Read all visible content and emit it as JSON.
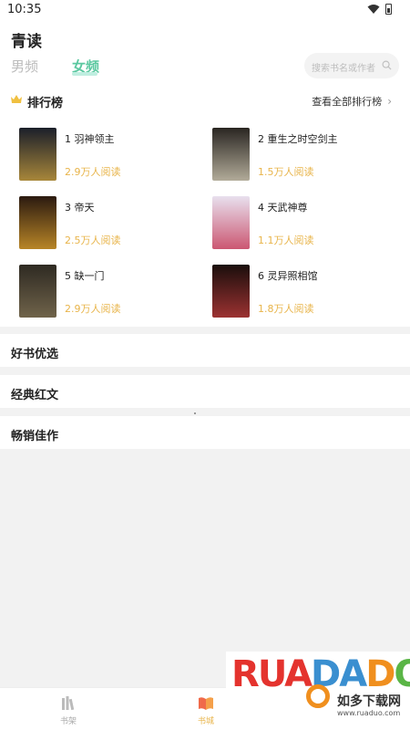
{
  "status": {
    "time": "10:35"
  },
  "header": {
    "title": "青读",
    "tabs": [
      {
        "label": "男频",
        "active": false
      },
      {
        "label": "女频",
        "active": true
      }
    ],
    "search_placeholder": "搜索书名或作者"
  },
  "ranking": {
    "title": "排行榜",
    "view_all": "查看全部排行榜",
    "books": [
      {
        "name": "1 羽神领主",
        "reads": "2.9万人阅读",
        "cover_color": "#1b1f2a",
        "cover_accent": "#e0b040"
      },
      {
        "name": "2 重生之时空剑主",
        "reads": "1.5万人阅读",
        "cover_color": "#2a2622",
        "cover_accent": "#e8e0c8"
      },
      {
        "name": "3 帝天",
        "reads": "2.5万人阅读",
        "cover_color": "#2b1a10",
        "cover_accent": "#f0b030"
      },
      {
        "name": "4 天武神尊",
        "reads": "1.1万人阅读",
        "cover_color": "#e8e0ee",
        "cover_accent": "#c02040"
      },
      {
        "name": "5 缺一门",
        "reads": "2.9万人阅读",
        "cover_color": "#2e2a22",
        "cover_accent": "#8a7a5a"
      },
      {
        "name": "6 灵异照相馆",
        "reads": "1.8万人阅读",
        "cover_color": "#1a0e0c",
        "cover_accent": "#d04040"
      }
    ]
  },
  "sections": [
    "好书优选",
    "经典红文",
    "畅销佳作"
  ],
  "bottom_nav": [
    {
      "label": "书架",
      "active": false
    },
    {
      "label": "书城",
      "active": true
    }
  ],
  "watermark": {
    "logo": "RUAODADO",
    "cn": "如多下载网",
    "url": "www.ruaduo.com"
  },
  "colors": {
    "accent": "#5bc8a0",
    "reads": "#e8b44a"
  }
}
